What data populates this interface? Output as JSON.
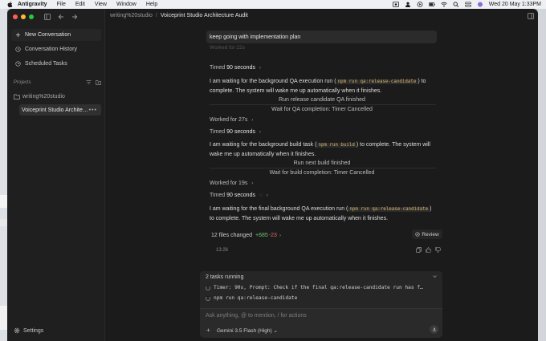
{
  "menubar": {
    "app_name": "Antigravity",
    "menus": [
      "File",
      "Edit",
      "View",
      "Window",
      "Help"
    ],
    "datetime": "Wed 20 May  1:33PM"
  },
  "sidebar": {
    "new_conversation": "New Conversation",
    "conversation_history": "Conversation History",
    "scheduled_tasks": "Scheduled Tasks",
    "projects_label": "Projects",
    "folder": "writing%20studio",
    "project_item": "Voiceprint Studio Archite…",
    "more": "•••",
    "settings": "Settings"
  },
  "breadcrumb": {
    "workspace": "writing%20studio",
    "separator": "/",
    "title": "Voiceprint Studio Architecture Audit"
  },
  "chat": {
    "user_message": "keep going with implementation plan",
    "faded_line": "Worked for 22s",
    "block1": {
      "timed_prefix": "Timed",
      "timed_value": "90 seconds",
      "text_before": "I am waiting for the background QA execution run (",
      "code": "npm run qa:release-candidate",
      "text_after": ") to complete. The system will wake me up automatically when it finishes."
    },
    "step1": "Run release candidate QA finished",
    "step2": "Wait for QA completion: Timer Cancelled",
    "worked1": "Worked for 27s",
    "block2": {
      "timed_prefix": "Timed",
      "timed_value": "90 seconds",
      "text_before": "I am waiting for the background build task (",
      "code": "npm run build",
      "text_after": ") to complete. The system will wake me up automatically when it finishes."
    },
    "step3": "Run next build finished",
    "step4": "Wait for build completion: Timer Cancelled",
    "worked2": "Worked for 19s",
    "block3": {
      "timed_prefix": "Timed",
      "timed_value": "90 seconds",
      "text_before": "I am waiting for the final background QA execution run (",
      "code": "npm run qa:release-candidate",
      "text_after": ") to complete. The system will wake me up automatically when it finishes."
    },
    "files_changed": "12 files changed",
    "additions": "+685",
    "deletions": "-23",
    "review": "Review",
    "timestamp": "13:26"
  },
  "tasks": {
    "header": "2 tasks running",
    "items": [
      "Timer: 90s, Prompt: Check if the final qa:release-candidate run has f…",
      "npm run qa:release-candidate"
    ]
  },
  "input": {
    "placeholder": "Ask anything, @ to mention, / for actions",
    "plus": "+",
    "model": "Gemini 3.5 Flash (High)"
  },
  "colors": {
    "window_bg": "#1b1b1b",
    "sidebar_bg": "#1f1f1f",
    "code_text": "#d6b26a",
    "additions": "#6ec074",
    "deletions": "#e06c6c"
  }
}
